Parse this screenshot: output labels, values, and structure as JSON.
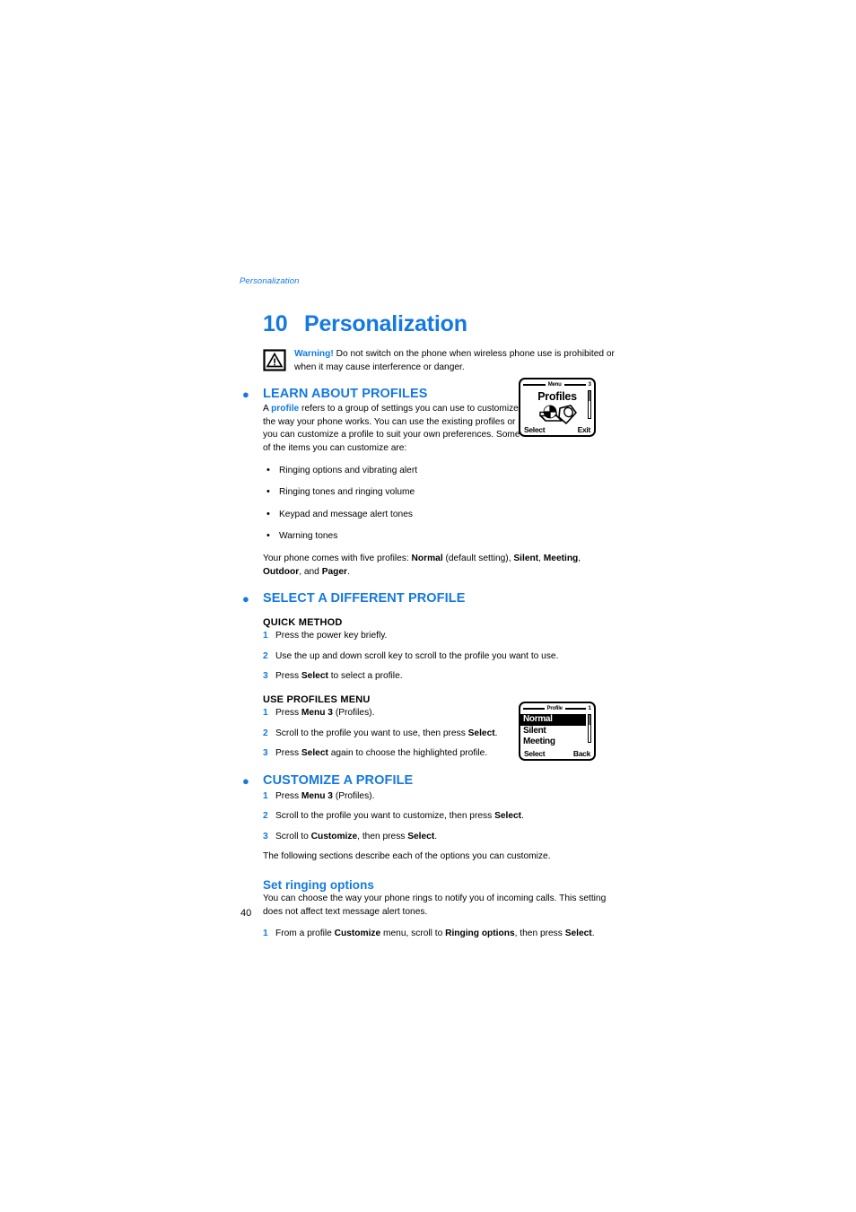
{
  "document": {
    "running_header": "Personalization",
    "page_number": "40",
    "accent_color": "#1479e0"
  },
  "chapter": {
    "number": "10",
    "title": "Personalization"
  },
  "warning": {
    "icon": "warning-triangle-icon",
    "label": "Warning!",
    "text": " Do not switch on the phone when wireless phone use is prohibited or when it may cause interference or danger."
  },
  "sections": {
    "learn_about_profiles": {
      "heading": "LEARN ABOUT PROFILES",
      "intro_prefix": "A ",
      "intro_keyword": "profile",
      "intro_rest": " refers to a group of settings you can use to customize the way your phone works. You can use the existing profiles or you can customize a profile to suit your own preferences. Some of the items you can customize are:",
      "items": [
        "Ringing options and vibrating alert",
        "Ringing tones and ringing volume",
        "Keypad and message alert tones",
        "Warning tones"
      ],
      "closing": {
        "lead": "Your phone comes with five profiles: ",
        "p1": "Normal",
        "p1_note": " (default setting), ",
        "p2": "Silent",
        "sep1": ", ",
        "p3": "Meeting",
        "sep2": ", ",
        "p4": "Outdoor",
        "sep3": ", and ",
        "p5": "Pager",
        "end": "."
      }
    },
    "select_a_different_profile": {
      "heading": "SELECT A DIFFERENT PROFILE",
      "quick_method": {
        "subheading": "QUICK METHOD",
        "steps": [
          {
            "num": "1",
            "pre": "Press the power key briefly.",
            "bold": "",
            "post": ""
          },
          {
            "num": "2",
            "pre": "Use the up and down scroll key to scroll to the profile you want to use.",
            "bold": "",
            "post": ""
          },
          {
            "num": "3",
            "pre": "Press ",
            "bold": "Select",
            "post": " to select a profile."
          }
        ]
      },
      "use_profiles_menu": {
        "subheading": "USE PROFILES MENU",
        "steps": [
          {
            "num": "1",
            "pre": "Press ",
            "bold": "Menu 3",
            "post": " (Profiles)."
          },
          {
            "num": "2",
            "pre": "Scroll to the profile you want to use, then press ",
            "bold": "Select",
            "post": "."
          },
          {
            "num": "3",
            "pre": "Press ",
            "bold": "Select",
            "post": " again to choose the highlighted profile."
          }
        ]
      }
    },
    "customize_a_profile": {
      "heading": "CUSTOMIZE A PROFILE",
      "steps": [
        {
          "num": "1",
          "pre": "Press ",
          "bold": "Menu 3",
          "post": " (Profiles)."
        },
        {
          "num": "2",
          "pre": "Scroll to the profile you want to customize, then press ",
          "bold": "Select",
          "post": "."
        },
        {
          "num": "3",
          "pre": "Scroll to ",
          "bold": "Customize",
          "post": ", then press ",
          "bold2": "Select",
          "post2": "."
        }
      ],
      "closing": "The following sections describe each of the options you can customize."
    },
    "set_ringing_options": {
      "heading": "Set ringing options",
      "body": "You can choose the way your phone rings to notify you of incoming calls. This setting does not affect text message alert tones.",
      "steps": [
        {
          "num": "1",
          "pre": "From a profile ",
          "bold": "Customize",
          "mid": " menu, scroll to ",
          "bold2": "Ringing options",
          "mid2": ", then press ",
          "bold3": "Select",
          "post": "."
        }
      ]
    }
  },
  "figures": {
    "profiles_menu_screen": {
      "title_label": "Menu",
      "title_number": "3",
      "center_title": "Profiles",
      "icon": "profiles-phone-icon",
      "softkey_left": "Select",
      "softkey_right": "Exit"
    },
    "profile_list_screen": {
      "title_label": "Profile",
      "title_number": "1",
      "items": [
        {
          "label": "Normal",
          "selected": true
        },
        {
          "label": "Silent",
          "selected": false
        },
        {
          "label": "Meeting",
          "selected": false
        }
      ],
      "softkey_left": "Select",
      "softkey_right": "Back"
    }
  }
}
